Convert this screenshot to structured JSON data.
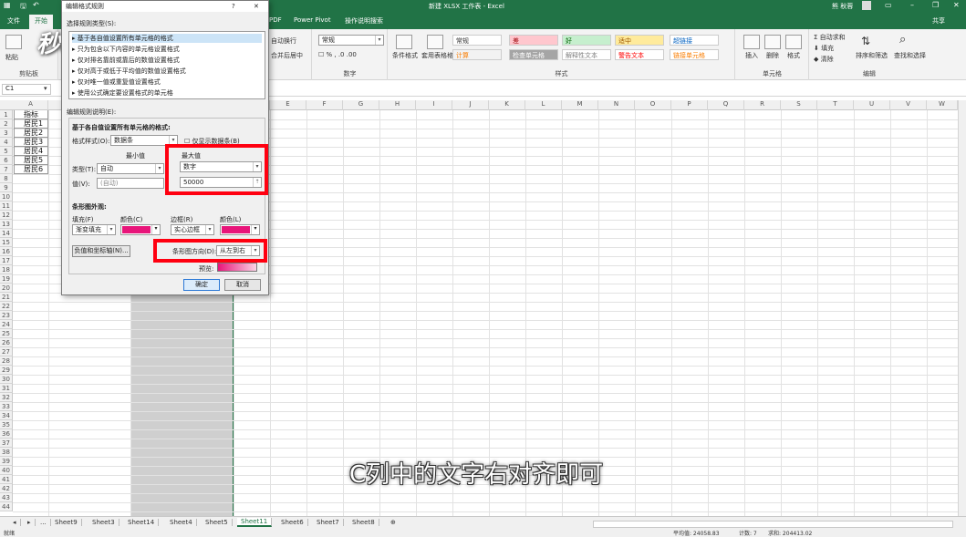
{
  "window": {
    "title": "新建 XLSX 工作表 - Excel",
    "user": "熊 秋蓉",
    "share": "共享"
  },
  "ribbon_tabs": [
    "文件",
    "开始",
    "PDF",
    "Power Pivot",
    "操作说明搜索"
  ],
  "ribbon": {
    "wrap_text": "自动换行",
    "merge": "合并后居中",
    "number_format": "常规",
    "number_group": "数字",
    "styles_group": "样式",
    "cells_group": "单元格",
    "edit_group": "编辑",
    "clipboard_group": "剪贴板",
    "paste": "粘贴",
    "cond_format": "条件格式",
    "table_format": "套用表格格式",
    "style_cells": [
      {
        "label": "常规",
        "bg": "#ffffff",
        "fg": "#333333"
      },
      {
        "label": "差",
        "bg": "#ffc7ce",
        "fg": "#9c0006"
      },
      {
        "label": "好",
        "bg": "#c6efce",
        "fg": "#006100"
      },
      {
        "label": "适中",
        "bg": "#ffeb9c",
        "fg": "#9c5700"
      },
      {
        "label": "超链接",
        "bg": "#ffffff",
        "fg": "#0563c1"
      },
      {
        "label": "计算",
        "bg": "#f2f2f2",
        "fg": "#fa7d00"
      },
      {
        "label": "检查单元格",
        "bg": "#a5a5a5",
        "fg": "#ffffff"
      },
      {
        "label": "解释性文本",
        "bg": "#ffffff",
        "fg": "#7f7f7f"
      },
      {
        "label": "警告文本",
        "bg": "#ffffff",
        "fg": "#ff0000"
      },
      {
        "label": "链接单元格",
        "bg": "#ffffff",
        "fg": "#fa7d00"
      }
    ],
    "insert": "插入",
    "delete": "删除",
    "format": "格式",
    "autosum": "自动求和",
    "fill": "填充",
    "clear": "清除",
    "sort_filter": "排序和筛选",
    "find_select": "查找和选择"
  },
  "namebox": "C1",
  "columns": [
    "A",
    "B",
    "C",
    "D",
    "E",
    "F",
    "G",
    "H",
    "I",
    "J",
    "K",
    "L",
    "M",
    "N",
    "O",
    "P",
    "Q",
    "R",
    "S",
    "T",
    "U",
    "V",
    "W"
  ],
  "cells_A": [
    "指标",
    "居民1",
    "居民2",
    "居民3",
    "居民4",
    "居民5",
    "居民6"
  ],
  "sheet_tabs": [
    "Sheet9",
    "Sheet3",
    "Sheet14",
    "Sheet4",
    "Sheet5",
    "Sheet11",
    "Sheet6",
    "Sheet7",
    "Sheet8"
  ],
  "active_sheet": "Sheet11",
  "status": {
    "ready": "就绪",
    "avg": "平均值: 24058.83",
    "count": "计数: 7",
    "sum": "求和: 204413.02"
  },
  "dialog": {
    "title": "编辑格式规则",
    "help": "?",
    "close": "✕",
    "select_rule_type": "选择规则类型(S):",
    "rules": [
      "▸ 基于各自值设置所有单元格的格式",
      "▸ 只为包含以下内容的单元格设置格式",
      "▸ 仅对排名靠前或靠后的数值设置格式",
      "▸ 仅对高于或低于平均值的数值设置格式",
      "▸ 仅对唯一值或重复值设置格式",
      "▸ 使用公式确定要设置格式的单元格"
    ],
    "edit_desc": "编辑规则说明(E):",
    "based_on": "基于各自值设置所有单元格的格式:",
    "format_style_label": "格式样式(O):",
    "format_style": "数据条",
    "show_bar_only": "仅显示数据条(B)",
    "min_label": "最小值",
    "max_label": "最大值",
    "type_label": "类型(T):",
    "value_label": "值(V):",
    "min_type": "自动",
    "min_value": "(自动)",
    "max_type": "数字",
    "max_value": "50000",
    "bar_appearance": "条形图外观:",
    "fill_label": "填充(F)",
    "color_label1": "颜色(C)",
    "border_label": "边框(R)",
    "color_label2": "颜色(L)",
    "fill_value": "渐变填充",
    "border_value": "实心边框",
    "bar_color": "#e8157a",
    "neg_axis": "负值和坐标轴(N)...",
    "direction_label": "条形图方向(D):",
    "direction_value": "从左到右",
    "preview_label": "预览:",
    "ok": "确定",
    "cancel": "取消"
  },
  "caption": "C列中的文字右对齐即可"
}
